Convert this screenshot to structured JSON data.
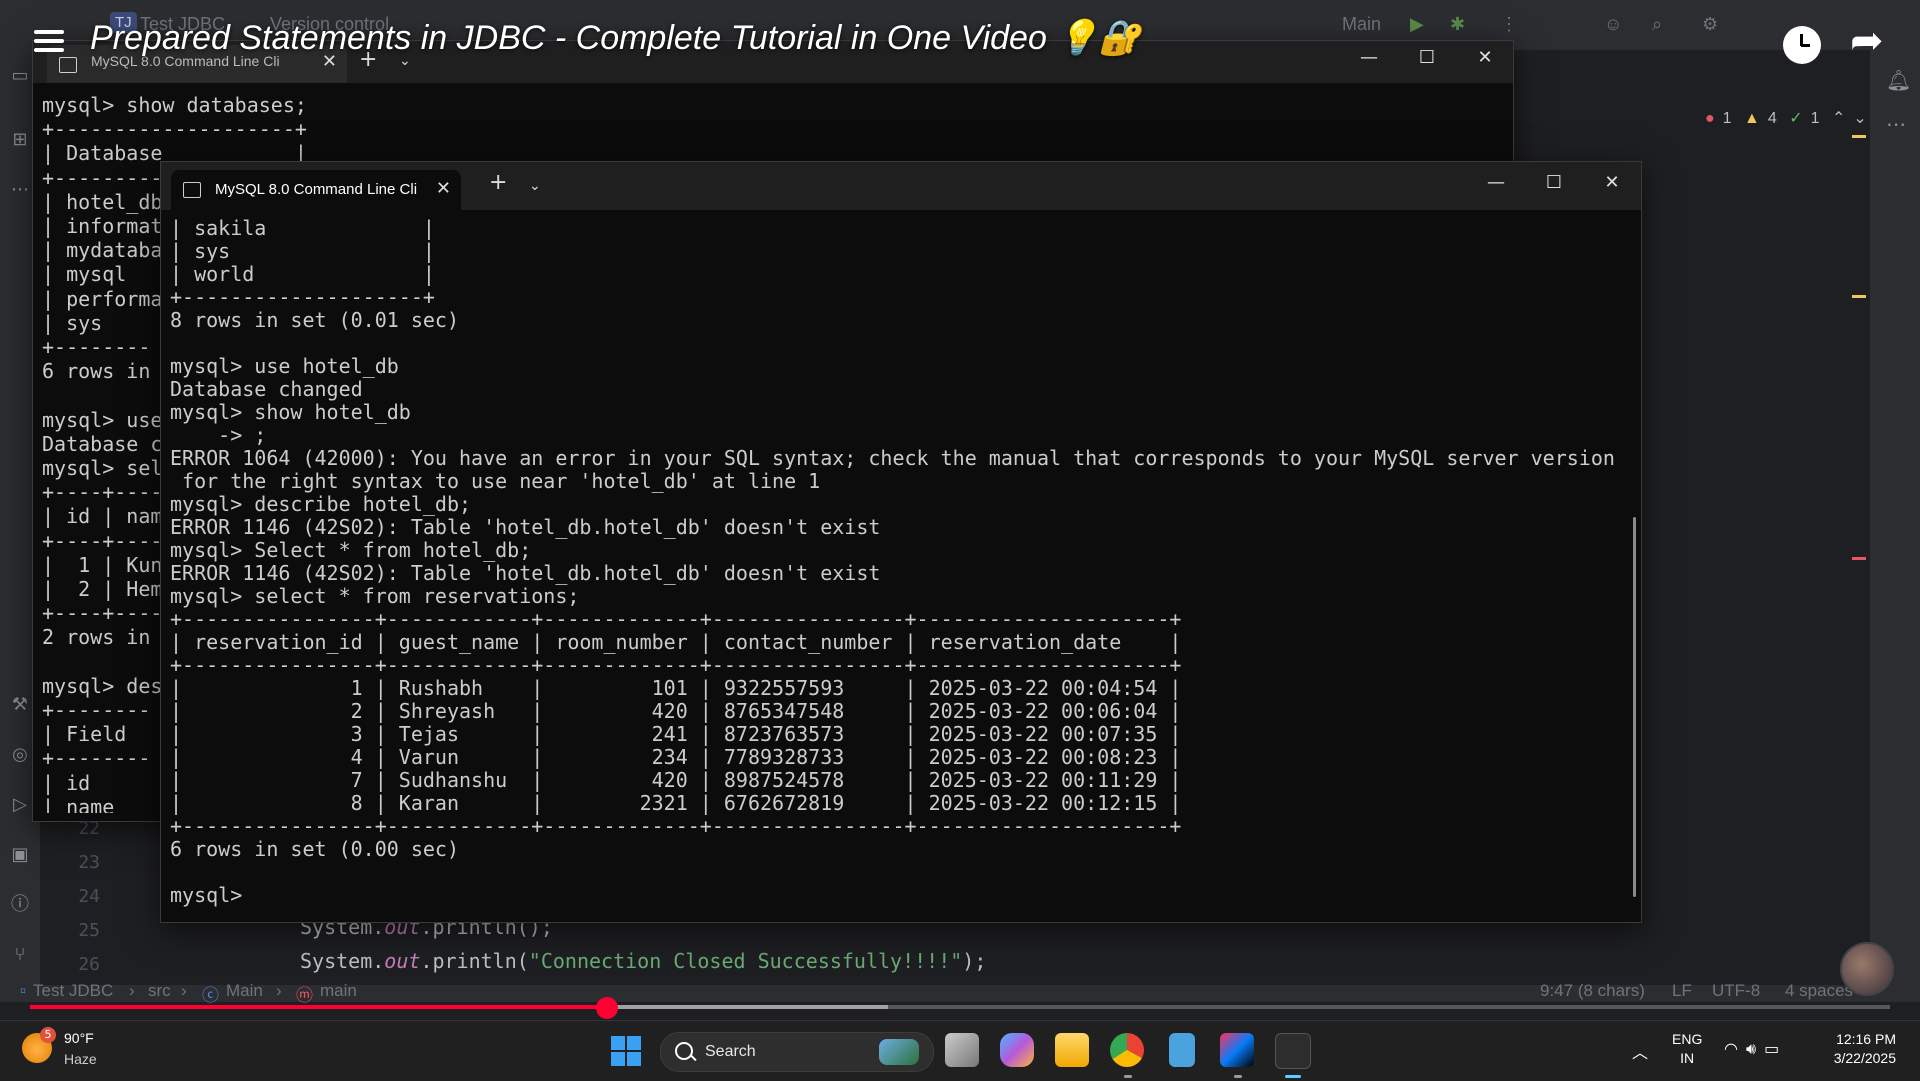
{
  "ide": {
    "project_badge": "TJ",
    "project_name": "Test JDBC",
    "version_control": "Version control",
    "run_config": "Main",
    "inspections": {
      "errors": "1",
      "warnings": "4",
      "weak": "1"
    },
    "gutter_lines": [
      "22",
      "23",
      "24",
      "25",
      "26"
    ],
    "code_lines": [
      {
        "obj": "System.",
        "field": "out",
        "rest": ".println();"
      },
      {
        "obj": "System.",
        "field": "out",
        "pre": ".println(",
        "str": "\"Connection Closed Successfully!!!!\"",
        "post": ");"
      }
    ],
    "status": {
      "breadcrumb": [
        "Test JDBC",
        "src",
        "Main",
        "main"
      ],
      "position": "9:47 (8 chars)",
      "line_sep": "LF",
      "encoding": "UTF-8",
      "indent": "4 spaces"
    },
    "colors": {
      "error": "#e55765",
      "warning": "#f2c55c",
      "ok": "#5fb865"
    }
  },
  "video": {
    "title": "Prepared Statements in JDBC - Complete Tutorial in One Video 💡🔐",
    "progress_fraction": 0.31
  },
  "terminal_back": {
    "tab_title": "MySQL 8.0 Command Line Cli",
    "lines": [
      "mysql> show databases;",
      "+--------------------+",
      "| Database           |",
      "+--------------------+",
      "| hotel_db",
      "| informat",
      "| mydataba",
      "| mysql",
      "| performa",
      "| sys",
      "+--------",
      "6 rows in",
      "",
      "mysql> use",
      "Database c",
      "mysql> sel",
      "+----+----",
      "| id | nam",
      "+----+----",
      "|  1 | Kun",
      "|  2 | Hem",
      "+----+----",
      "2 rows in",
      "",
      "mysql> des",
      "+--------",
      "| Field",
      "+--------",
      "| id",
      "| name"
    ]
  },
  "terminal_front": {
    "tab_title": "MySQL 8.0 Command Line Cli",
    "lines": [
      "| sakila             |",
      "| sys                |",
      "| world              |",
      "+--------------------+",
      "8 rows in set (0.01 sec)",
      "",
      "mysql> use hotel_db",
      "Database changed",
      "mysql> show hotel_db",
      "    -> ;",
      "ERROR 1064 (42000): You have an error in your SQL syntax; check the manual that corresponds to your MySQL server version",
      " for the right syntax to use near 'hotel_db' at line 1",
      "mysql> describe hotel_db;",
      "ERROR 1146 (42S02): Table 'hotel_db.hotel_db' doesn't exist",
      "mysql> Select * from hotel_db;",
      "ERROR 1146 (42S02): Table 'hotel_db.hotel_db' doesn't exist",
      "mysql> select * from reservations;",
      "+----------------+------------+-------------+----------------+---------------------+",
      "| reservation_id | guest_name | room_number | contact_number | reservation_date    |",
      "+----------------+------------+-------------+----------------+---------------------+",
      "|              1 | Rushabh    |         101 | 9322557593     | 2025-03-22 00:04:54 |",
      "|              2 | Shreyash   |         420 | 8765347548     | 2025-03-22 00:06:04 |",
      "|              3 | Tejas      |         241 | 8723763573     | 2025-03-22 00:07:35 |",
      "|              4 | Varun      |         234 | 7789328733     | 2025-03-22 00:08:23 |",
      "|              7 | Sudhanshu  |         420 | 8987524578     | 2025-03-22 00:11:29 |",
      "|              8 | Karan      |        2321 | 6762672819     | 2025-03-22 00:12:15 |",
      "+----------------+------------+-------------+----------------+---------------------+",
      "6 rows in set (0.00 sec)",
      "",
      "mysql>"
    ]
  },
  "taskbar": {
    "weather_badge": "5",
    "temperature": "90°F",
    "condition": "Haze",
    "search_label": "Search",
    "lang_line1": "ENG",
    "lang_line2": "IN",
    "time": "12:16 PM",
    "date": "3/22/2025"
  }
}
